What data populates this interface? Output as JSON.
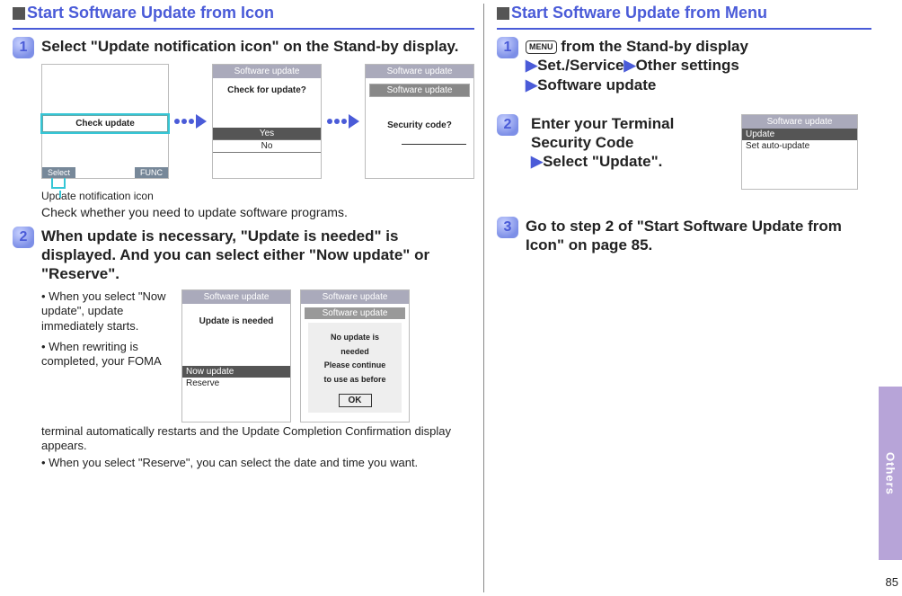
{
  "left": {
    "section_title": "Start Software Update from Icon",
    "step1_title": "Select \"Update notification icon\" on the Stand-by display.",
    "caption": "Update notification icon",
    "step1_sub": "Check whether you need to update software programs.",
    "step2_title": "When update is necessary, \"Update is needed\" is displayed. And you can select either \"Now update\" or \"Reserve\".",
    "bullet1": "• When you select \"Now update\", update immediately starts.",
    "bullet2": "• When rewriting is completed, your FOMA",
    "bullet2b": "terminal automatically restarts and the Update Completion Confirmation display appears.",
    "bullet3": "• When you select \"Reserve\", you can select the date and time you want.",
    "scA_label": "Check update",
    "scA_soft_l": "Select",
    "scA_soft_r": "FUNC",
    "scB_hdr": "Software update",
    "scB_q": "Check for update?",
    "scB_yes": "Yes",
    "scB_no": "No",
    "scC_hdr": "Software update",
    "scC_hdr2": "Software update",
    "scC_sec": "Security code?",
    "scD_hdr": "Software update",
    "scD_msg": "Update is needed",
    "scD_m1": "Now update",
    "scD_m2": "Reserve",
    "scE_hdr": "Software update",
    "scE_hdr2": "Software update",
    "scE_info1": "No update is",
    "scE_info2": "needed",
    "scE_info3": "Please continue",
    "scE_info4": "to use as before",
    "scE_ok": "OK"
  },
  "right": {
    "section_title": "Start Software Update from Menu",
    "step1_a": " from the Stand-by display",
    "step1_b1": "Set./Service",
    "step1_b2": "Other settings",
    "step1_c": "Software update",
    "menu_label": "MENU",
    "step2_a": "Enter your Terminal Security Code",
    "step2_b": "Select \"Update\".",
    "step3": "Go to step 2 of \"Start Software Update from Icon\" on page 85.",
    "scF_hdr": "Software update",
    "scF_m1": "Update",
    "scF_m2": "Set auto-update"
  },
  "side_tab": "Others",
  "page_num": "85"
}
